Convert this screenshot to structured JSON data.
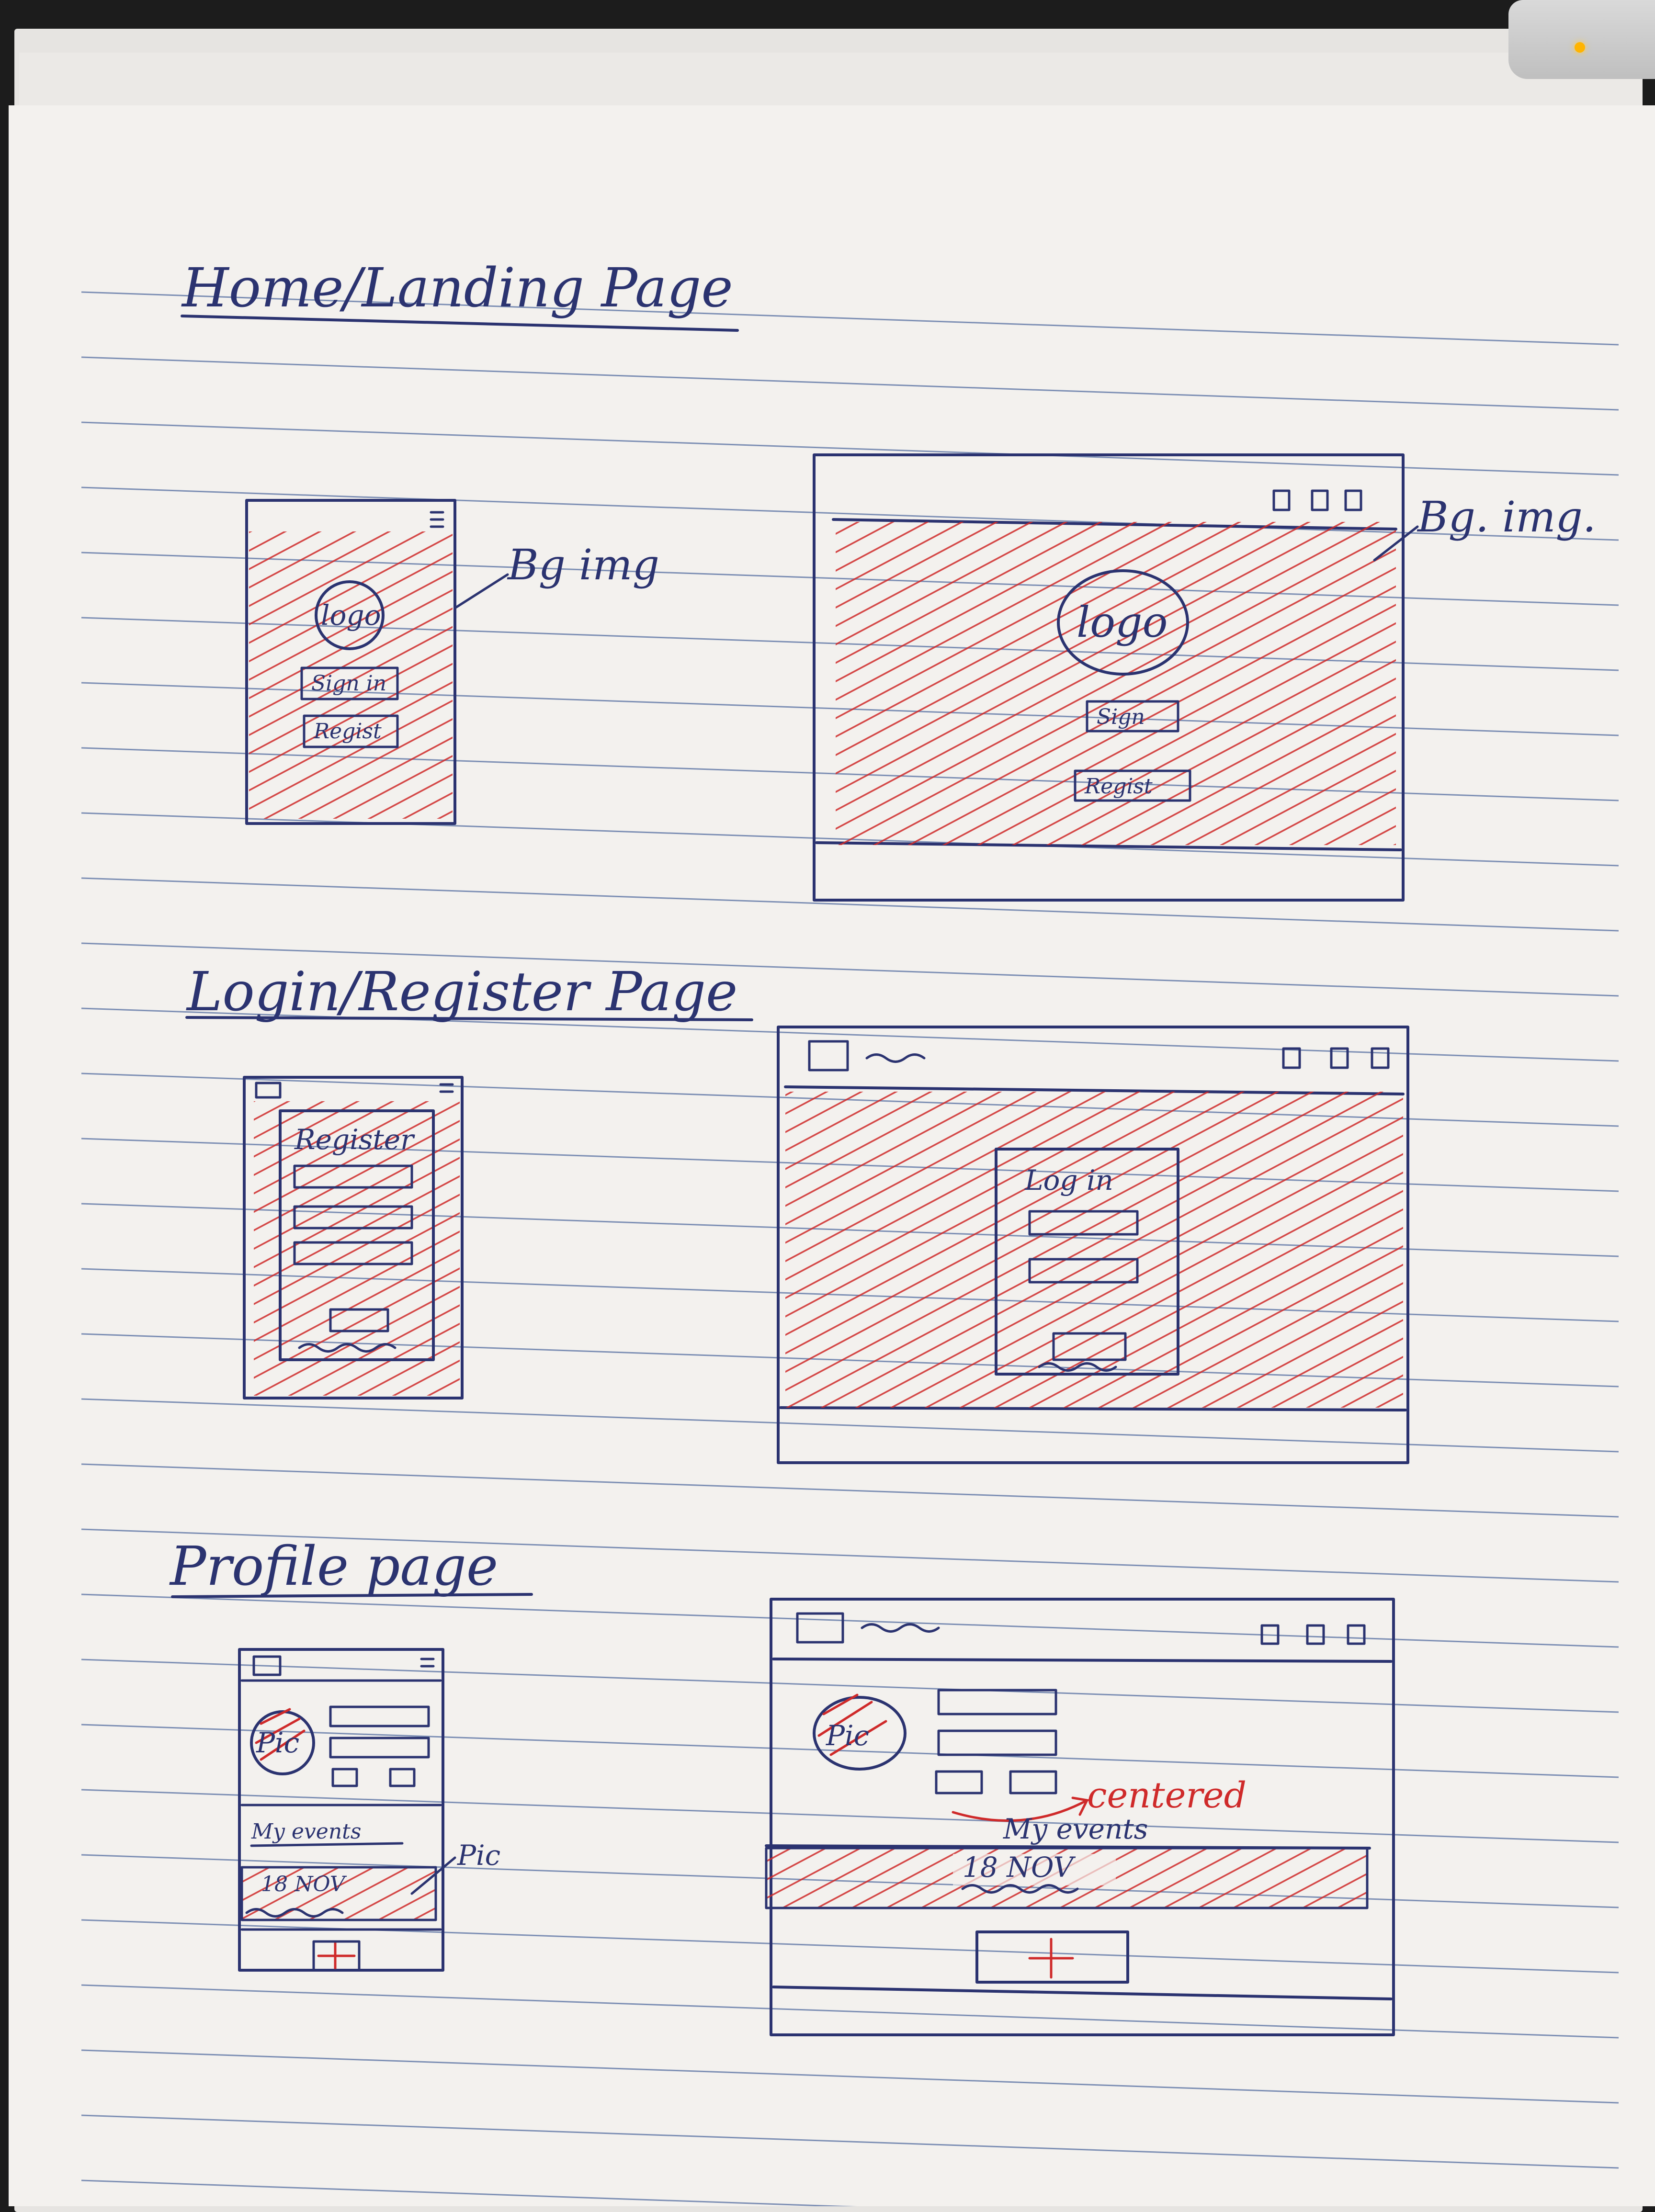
{
  "sections": {
    "home": {
      "title": "Home/Landing Page"
    },
    "login": {
      "title": "Login/Register Page"
    },
    "profile": {
      "title": "Profile page"
    }
  },
  "home": {
    "mobile": {
      "logo": "logo",
      "signin": "Sign in",
      "register": "Regist"
    },
    "desktop": {
      "logo": "logo",
      "signin": "Sign",
      "register": "Regist"
    },
    "annotation_mobile": "Bg img",
    "annotation_desktop": "Bg. img."
  },
  "login": {
    "mobile": {
      "heading": "Register"
    },
    "desktop": {
      "heading": "Log in"
    }
  },
  "profile": {
    "mobile": {
      "pic": "Pic",
      "my_events": "My events",
      "event_date": "18 NOV"
    },
    "desktop": {
      "pic": "Pic",
      "my_events": "My events",
      "event_date": "18 NOV"
    },
    "annotation_pic": "Pic",
    "annotation_centered": "centered"
  },
  "colors": {
    "ink": "#2b3370",
    "red": "#cf2a2a",
    "paper": "#f3f1ee"
  }
}
